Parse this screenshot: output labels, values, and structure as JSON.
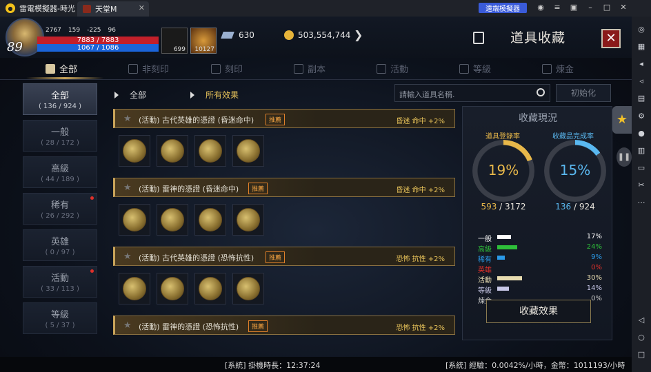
{
  "window": {
    "app_name": "雷電模擬器-時光",
    "tab_title": "天堂M",
    "sync_label": "遠端模擬器"
  },
  "player": {
    "level": "89",
    "stat1": "2767",
    "stat2": "159",
    "stat3": "-225",
    "stat4": "96",
    "hp": "7883 / 7883",
    "mp": "1067 / 1086",
    "buff1_count": "699",
    "buff2_count": "10127"
  },
  "currency": {
    "diamonds": "630",
    "adena": "503,554,744"
  },
  "page_title": "道具收藏",
  "tabs": [
    {
      "label": "全部",
      "active": true
    },
    {
      "label": "非刻印",
      "active": false
    },
    {
      "label": "刻印",
      "active": false
    },
    {
      "label": "副本",
      "active": false
    },
    {
      "label": "活動",
      "active": false
    },
    {
      "label": "等級",
      "active": false
    },
    {
      "label": "煉金",
      "active": false
    }
  ],
  "categories": [
    {
      "name": "全部",
      "count": "( 136 / 924 )",
      "active": true,
      "dot": false
    },
    {
      "name": "一般",
      "count": "( 28 / 172 )",
      "active": false,
      "dot": false
    },
    {
      "name": "高級",
      "count": "( 44 / 189 )",
      "active": false,
      "dot": false
    },
    {
      "name": "稀有",
      "count": "( 26 / 292 )",
      "active": false,
      "dot": true
    },
    {
      "name": "英雄",
      "count": "( 0 / 97 )",
      "active": false,
      "dot": false
    },
    {
      "name": "活動",
      "count": "( 33 / 113 )",
      "active": false,
      "dot": true
    },
    {
      "name": "等級",
      "count": "( 5 / 37 )",
      "active": false,
      "dot": false
    }
  ],
  "filters": {
    "category": "全部",
    "effect": "所有效果"
  },
  "search": {
    "placeholder": "請輸入道具名稱.",
    "reset_label": "初始化"
  },
  "entries": [
    {
      "name": "(活動) 古代英雄的憑證 (昏迷命中)",
      "tag": "推薦",
      "effect": "昏迷 命中 +2%",
      "slots": 4
    },
    {
      "name": "(活動) 雷神的憑證 (昏迷命中)",
      "tag": "推薦",
      "effect": "昏迷 命中 +2%",
      "slots": 4
    },
    {
      "name": "(活動) 古代英雄的憑證 (恐怖抗性)",
      "tag": "推薦",
      "effect": "恐怖 抗性 +2%",
      "slots": 4
    },
    {
      "name": "(活動) 雷神的憑證 (恐怖抗性)",
      "tag": "推薦",
      "effect": "恐怖 抗性 +2%",
      "slots": 4
    }
  ],
  "summary": {
    "title": "收藏現況",
    "left": {
      "label": "道具登錄率",
      "percent": "19%",
      "value": 19,
      "current": "593",
      "total": " / 3172",
      "color": "#e8b84a"
    },
    "right": {
      "label": "收藏品完成率",
      "percent": "15%",
      "value": 15,
      "current": "136",
      "total": " / 924",
      "color": "#5ab8f0"
    },
    "grades": [
      {
        "label": "一般",
        "pct": "17%",
        "value": 17,
        "color": "#ffffff"
      },
      {
        "label": "高級",
        "pct": "24%",
        "value": 24,
        "color": "#2ec03a"
      },
      {
        "label": "稀有",
        "pct": "9%",
        "value": 9,
        "color": "#2a9ae8"
      },
      {
        "label": "英雄",
        "pct": "0%",
        "value": 0,
        "color": "#e0302a"
      },
      {
        "label": "活動",
        "pct": "30%",
        "value": 30,
        "color": "#e8dcb0"
      },
      {
        "label": "等級",
        "pct": "14%",
        "value": 14,
        "color": "#c8c8e8"
      },
      {
        "label": "煉金",
        "pct": "0%",
        "value": 0,
        "color": "#c8c8c8"
      }
    ],
    "button_label": "收藏效果"
  },
  "status": {
    "left": "[系統] 掛機時長：12:37:24",
    "right": "[系統] 經驗：0.0042%/小時，金幣：1011193/小時"
  }
}
